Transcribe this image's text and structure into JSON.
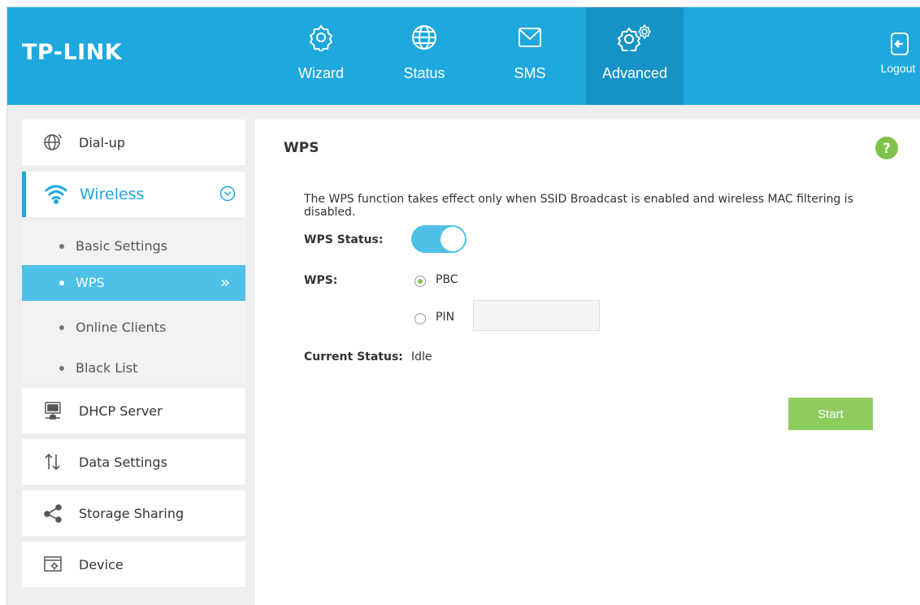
{
  "header": {
    "logo": "TP-LINK",
    "nav": [
      {
        "label": "Wizard",
        "icon": "gear-icon"
      },
      {
        "label": "Status",
        "icon": "globe-icon"
      },
      {
        "label": "SMS",
        "icon": "envelope-icon"
      },
      {
        "label": "Advanced",
        "icon": "double-gear-icon"
      }
    ],
    "logout": "Logout"
  },
  "sidebar": {
    "items": [
      {
        "label": "Dial-up",
        "icon": "globe-icon"
      },
      {
        "label": "Wireless",
        "icon": "wifi-icon"
      },
      {
        "label": "DHCP Server",
        "icon": "server-icon"
      },
      {
        "label": "Data Settings",
        "icon": "up-down-arrows-icon"
      },
      {
        "label": "Storage Sharing",
        "icon": "share-icon"
      },
      {
        "label": "Device",
        "icon": "device-settings-icon"
      }
    ],
    "wireless_sub": [
      {
        "label": "Basic Settings"
      },
      {
        "label": "WPS"
      },
      {
        "label": "Online Clients"
      },
      {
        "label": "Black List"
      }
    ],
    "active_sub_marker": "»"
  },
  "main": {
    "title": "WPS",
    "description": "The WPS function takes effect only when SSID Broadcast is enabled and wireless MAC filtering is disabled.",
    "wps_status_label": "WPS Status:",
    "wps_status_on": true,
    "wps_label": "WPS:",
    "options": [
      {
        "label": "PBC",
        "checked": true
      },
      {
        "label": "PIN",
        "checked": false
      }
    ],
    "pin_value": "",
    "current_status_label": "Current Status:",
    "current_status_value": "Idle",
    "start_button": "Start"
  },
  "colors": {
    "header_bg": "#1ea8de",
    "nav_active_bg": "#1693c6",
    "accent": "#1ea8de",
    "submenu_active": "#4fc0e8",
    "start_button": "#8fcc5e",
    "help": "#7fc24a"
  }
}
